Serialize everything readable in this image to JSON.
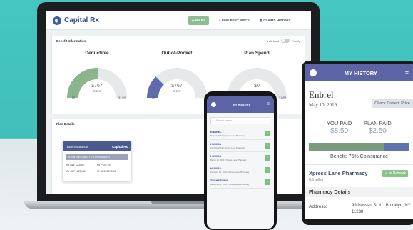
{
  "laptop": {
    "nav": {
      "brand": "Capital Rx",
      "links": [
        "MY RX",
        "FIND BEST PRICE",
        "CLAIMS HISTORY"
      ],
      "overflow_icon": "more-icon"
    },
    "benefit": {
      "title": "Benefit Information",
      "toggle_left": "Individual",
      "toggle_right": "Family",
      "gauges": [
        {
          "label": "Deductible",
          "value": "$767",
          "sub": "SPENT",
          "min": "$0",
          "max": "$1,500",
          "fraction": 0.51,
          "color": "#8bb58d"
        },
        {
          "label": "Out-of-Pocket",
          "value": "$767",
          "sub": "SPENT",
          "min": "$0",
          "max": "$",
          "fraction": 0.25,
          "color": "#5f6bab"
        },
        {
          "label": "Plan Spend",
          "value": "$0",
          "sub": "",
          "min": "",
          "max": "$1MM",
          "fraction": 0.0,
          "color": "#6a75b2"
        }
      ]
    },
    "plan": {
      "title": "Plan Details",
      "card": {
        "heading": "Your Insurance",
        "brand": "Capital Rx",
        "note": "SHOW THIS CARD TO A PHARMACIST",
        "fields": [
          "Rx BIN: 123456",
          "Rx PCN: CR",
          "Rx GRP: 123456",
          "ID: 12345678901"
        ]
      }
    }
  },
  "phone": {
    "title": "MY HISTORY",
    "search_placeholder": "Search claims",
    "items": [
      {
        "drug": "ENBREL",
        "meta": "May 10, 2019 | Xpress Lane Pharmacy"
      },
      {
        "drug": "HUMIRA",
        "meta": "April 10, 2019 | Xpress Lane Pharmacy"
      },
      {
        "drug": "HUMIRA",
        "meta": "March 10, 2019 | Xpress Lane Pharmacy"
      },
      {
        "drug": "HUMIRA",
        "meta": "February 10, 2019 | Xpress Lane Pharmacy"
      },
      {
        "drug": "TECHFIDERA",
        "meta": "December 5, 2018 | Xpress Lane Pharmacy"
      }
    ]
  },
  "tablet": {
    "title": "MY HISTORY",
    "drug": "Enbrel",
    "date": "May 10, 2019",
    "check_price": "Check Current Price",
    "you_paid_label": "YOU PAID",
    "you_paid": "$8.50",
    "plan_paid_label": "PLAN PAID",
    "plan_paid": "$2.50",
    "coinsurance_fraction": 0.75,
    "benefit": "Benefit: 75% Coinsurance",
    "pharmacy": "Xpress Lane Pharmacy",
    "distance": "0.5 miles",
    "network": "In Network",
    "section": "Pharmacy Details",
    "address_label": "Address:",
    "address": "99 Nassau St #1, Brooklyn, NY 11238"
  }
}
